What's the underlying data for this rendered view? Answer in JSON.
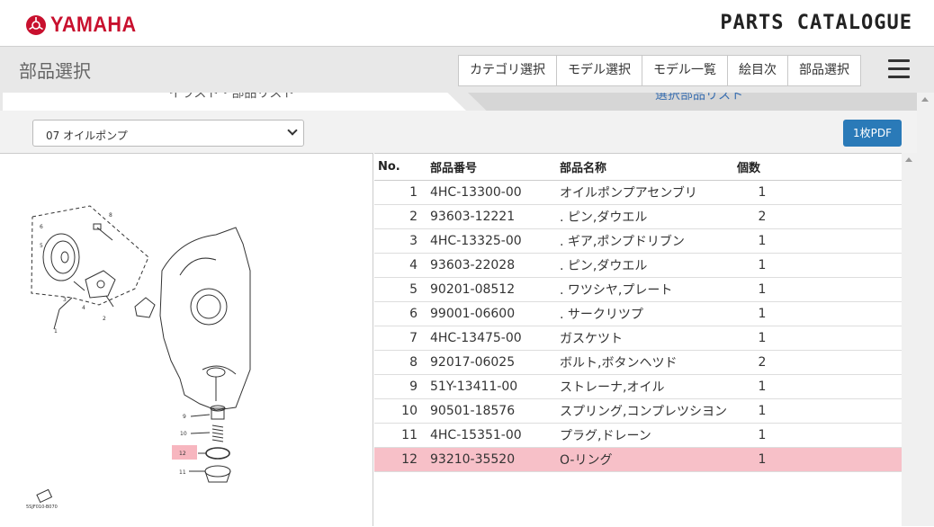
{
  "header": {
    "logo_text": "YAMAHA",
    "brand": "PARTS CATALOGUE",
    "brand_color": "#c8102e",
    "accent": "#2a7ab8"
  },
  "subheader": {
    "title": "部品選択",
    "nav": [
      "カテゴリ選択",
      "モデル選択",
      "モデル一覧",
      "絵目次",
      "部品選択"
    ]
  },
  "tabs": {
    "left": "イラスト・部品リスト",
    "right": "選択部品リスト"
  },
  "controls": {
    "selected_figure": "07 オイルポンプ",
    "pdf_button": "1枚PDF"
  },
  "illustration": {
    "code": "5SJF010-B070",
    "callouts": [
      "1",
      "2",
      "3",
      "4",
      "5",
      "6",
      "8",
      "9",
      "10",
      "11",
      "12"
    ]
  },
  "parts_table": {
    "columns": [
      "No.",
      "部品番号",
      "部品名称",
      "個数"
    ],
    "rows": [
      {
        "no": "1",
        "part_no": "4HC-13300-00",
        "name": "オイルポンプアセンブリ",
        "qty": "1"
      },
      {
        "no": "2",
        "part_no": "93603-12221",
        "name": ". ピン,ダウエル",
        "qty": "2"
      },
      {
        "no": "3",
        "part_no": "4HC-13325-00",
        "name": ". ギア,ポンプドリブン",
        "qty": "1"
      },
      {
        "no": "4",
        "part_no": "93603-22028",
        "name": ". ピン,ダウエル",
        "qty": "1"
      },
      {
        "no": "5",
        "part_no": "90201-08512",
        "name": ". ワツシヤ,プレート",
        "qty": "1"
      },
      {
        "no": "6",
        "part_no": "99001-06600",
        "name": ". サークリツプ",
        "qty": "1"
      },
      {
        "no": "7",
        "part_no": "4HC-13475-00",
        "name": "ガスケツト",
        "qty": "1"
      },
      {
        "no": "8",
        "part_no": "92017-06025",
        "name": "ボルト,ボタンヘツド",
        "qty": "2"
      },
      {
        "no": "9",
        "part_no": "51Y-13411-00",
        "name": "ストレーナ,オイル",
        "qty": "1"
      },
      {
        "no": "10",
        "part_no": "90501-18576",
        "name": "スプリング,コンプレツシヨン",
        "qty": "1"
      },
      {
        "no": "11",
        "part_no": "4HC-15351-00",
        "name": "プラグ,ドレーン",
        "qty": "1"
      },
      {
        "no": "12",
        "part_no": "93210-35520",
        "name": "O-リング",
        "qty": "1"
      }
    ],
    "selected_row": "12",
    "selected_color": "#f7c0c8"
  },
  "icons": [
    "yamaha-emblem-icon",
    "gear-icon",
    "hamburger-menu-icon",
    "chevron-down-icon",
    "scroll-up-icon"
  ]
}
